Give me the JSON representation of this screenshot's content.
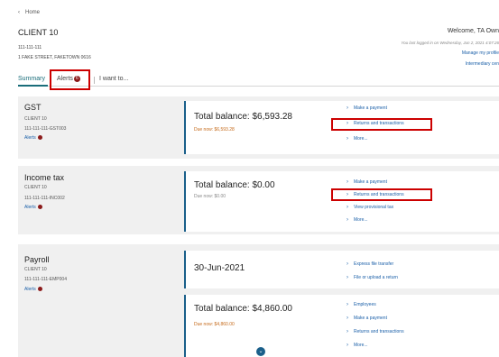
{
  "nav": {
    "home_label": "Home"
  },
  "client": {
    "title": "CLIENT 10",
    "id": "111-111-111",
    "address": "1 FAKE STREET, FAKETOWN 0616"
  },
  "header_right": {
    "welcome": "Welcome, TA Own",
    "last_login": "You last logged in on Wednesday, Jun 2, 2021 4:07:26",
    "manage_profile": "Manage my profile",
    "intermediary": "Intermediary cen"
  },
  "tabs": {
    "summary": "Summary",
    "alerts": "Alerts",
    "alerts_count": "6",
    "iwant": "I want to..."
  },
  "accounts": {
    "gst": {
      "name": "GST",
      "client": "CLIENT 10",
      "number": "111-111-111-GST003",
      "alerts": "Alerts",
      "balance": "Total balance: $6,593.28",
      "due": "Due now: $6,593.28",
      "links": [
        "Make a payment",
        "Returns and transactions",
        "More..."
      ]
    },
    "income": {
      "name": "Income tax",
      "client": "CLIENT 10",
      "number": "111-111-111-INC002",
      "alerts": "Alerts",
      "balance": "Total balance: $0.00",
      "due": "Due now: $0.00",
      "links": [
        "Make a payment",
        "Returns and transactions",
        "View provisional tax",
        "More..."
      ]
    },
    "payroll": {
      "name": "Payroll",
      "client": "CLIENT 10",
      "number": "111-111-111-EMP004",
      "alerts": "Alerts",
      "date": "30-Jun-2021",
      "date_links": [
        "Express file transfer",
        "File or upload a return"
      ],
      "balance": "Total balance: $4,860.00",
      "due": "Due now: $4,860.00",
      "links": [
        "Employees",
        "Make a payment",
        "Returns and transactions",
        "More..."
      ]
    }
  },
  "icons": {
    "chevron_left": "chevron-left-icon",
    "chevron_right": "chevron-right-icon",
    "chevron_down": "chevron-down-icon",
    "alert_dot": "alert-dot-icon"
  },
  "colors": {
    "accent": "#1a6d7a",
    "link": "#1a5fa8",
    "alert": "#8b1a1a",
    "due": "#c56a1a",
    "highlight_box": "#cc0000"
  }
}
